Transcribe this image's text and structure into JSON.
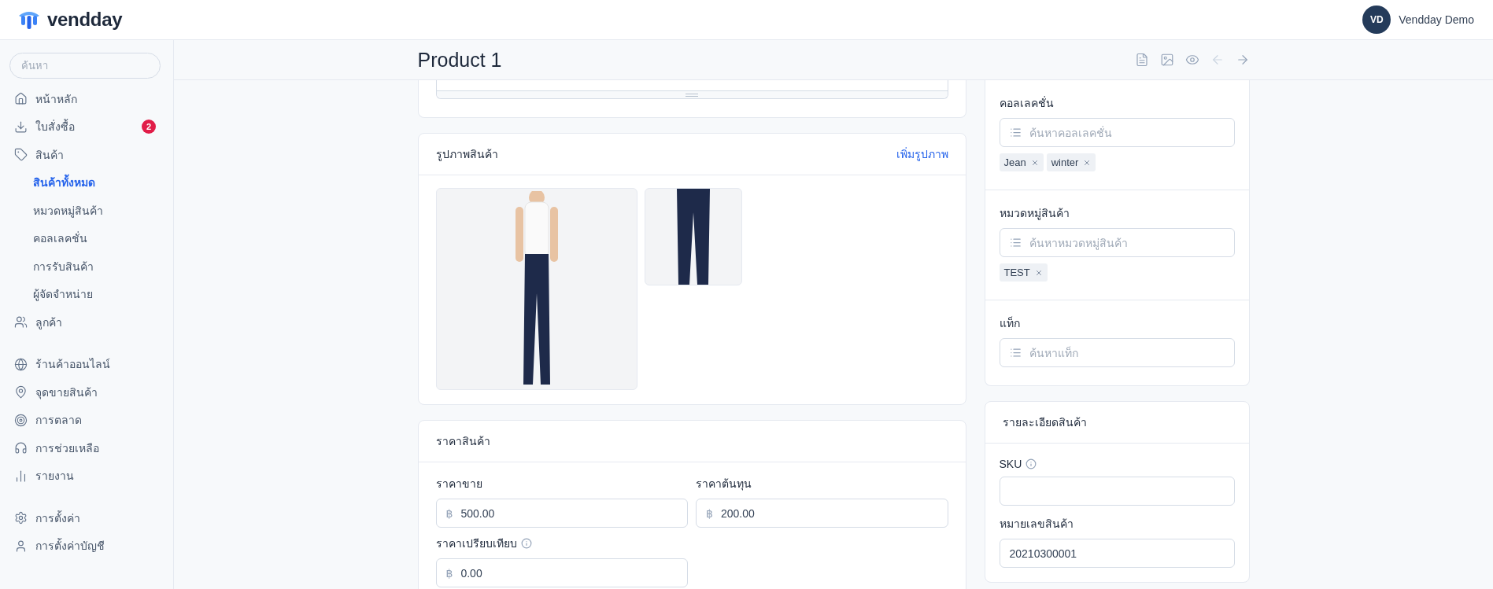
{
  "header": {
    "brand": "vendday",
    "user": {
      "initials": "VD",
      "name": "Vendday Demo"
    }
  },
  "sidebar": {
    "search": {
      "placeholder": "ค้นหา"
    },
    "groups": [
      {
        "items": [
          {
            "kind": "home",
            "label": "หน้าหลัก",
            "selected": false
          },
          {
            "kind": "download",
            "label": "ใบสั่งซื้อ",
            "badge": "2",
            "selected": false
          },
          {
            "kind": "tag",
            "label": "สินค้า",
            "selected": false,
            "children": [
              {
                "label": "สินค้าทั้งหมด",
                "selected": true
              },
              {
                "label": "หมวดหมู่สินค้า",
                "selected": false
              },
              {
                "label": "คอลเลคชั่น",
                "selected": false
              },
              {
                "label": "การรับสินค้า",
                "selected": false
              },
              {
                "label": "ผู้จัดจำหน่าย",
                "selected": false
              }
            ]
          },
          {
            "kind": "users",
            "label": "ลูกค้า",
            "selected": false
          }
        ]
      },
      {
        "items": [
          {
            "kind": "globe",
            "label": "ร้านค้าออนไลน์",
            "selected": false
          },
          {
            "kind": "pin",
            "label": "จุดขายสินค้า",
            "selected": false
          },
          {
            "kind": "target",
            "label": "การตลาด",
            "selected": false
          },
          {
            "kind": "headset",
            "label": "การช่วยเหลือ",
            "selected": false
          },
          {
            "kind": "chart",
            "label": "รายงาน",
            "selected": false
          }
        ]
      },
      {
        "items": [
          {
            "kind": "settings",
            "label": "การตั้งค่า",
            "selected": false
          },
          {
            "kind": "user",
            "label": "การตั้งค่าบัญชี",
            "selected": false
          }
        ]
      }
    ]
  },
  "page": {
    "title": "Product 1",
    "toolbar": [
      {
        "kind": "document",
        "disabled": false
      },
      {
        "kind": "image",
        "disabled": false
      },
      {
        "kind": "eye",
        "disabled": false
      },
      {
        "kind": "prev",
        "disabled": true
      },
      {
        "kind": "next",
        "disabled": false
      }
    ]
  },
  "images_card": {
    "title": "รูปภาพสินค้า",
    "action": "เพิ่มรูปภาพ",
    "photos": [
      {
        "kind": "large"
      },
      {
        "kind": "small"
      }
    ]
  },
  "price_card": {
    "title": "ราคาสินค้า",
    "currency": "฿",
    "fields": [
      {
        "label": "ราคาขาย",
        "value": "500.00",
        "info": false
      },
      {
        "label": "ราคาต้นทุน",
        "value": "200.00",
        "info": false
      },
      {
        "label": "ราคาเปรียบเทียบ",
        "value": "0.00",
        "info": true
      }
    ]
  },
  "organize_card": {
    "sections": [
      {
        "label": "คอลเลคชั่น",
        "placeholder": "ค้นหาคอลเลคชั่น",
        "tags": [
          "Jean",
          "winter"
        ]
      },
      {
        "label": "หมวดหมู่สินค้า",
        "placeholder": "ค้นหาหมวดหมู่สินค้า",
        "tags": [
          "TEST"
        ]
      },
      {
        "label": "แท็ก",
        "placeholder": "ค้นหาแท็ก"
      }
    ]
  },
  "details_card": {
    "title": "รายละเอียดสินค้า",
    "fields": [
      {
        "label": "SKU",
        "info": true
      },
      {
        "label": "หมายเลขสินค้า",
        "info": false,
        "value": "20210300001"
      }
    ]
  }
}
